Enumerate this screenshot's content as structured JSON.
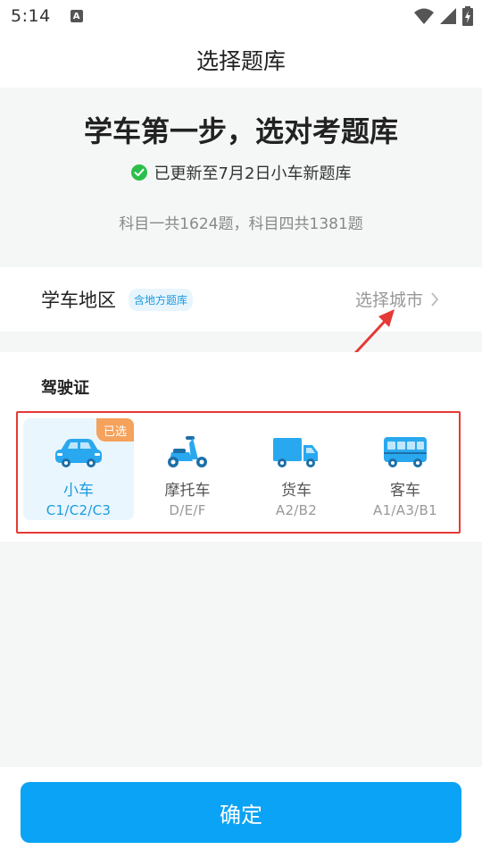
{
  "status_bar": {
    "time": "5:14",
    "notif_icon": "A"
  },
  "header": {
    "title": "选择题库"
  },
  "hero": {
    "headline": "学车第一步，选对考题库",
    "update_text": "已更新至7月2日小车新题库",
    "stats": "科目一共1624题，科目四共1381题"
  },
  "region": {
    "label": "学车地区",
    "badge": "含地方题库",
    "select_label": "选择城市"
  },
  "license": {
    "label": "驾驶证",
    "selected_badge": "已选",
    "vehicles": [
      {
        "name": "小车",
        "code": "C1/C2/C3",
        "icon": "car-icon",
        "selected": true
      },
      {
        "name": "摩托车",
        "code": "D/E/F",
        "icon": "motorcycle-icon",
        "selected": false
      },
      {
        "name": "货车",
        "code": "A2/B2",
        "icon": "truck-icon",
        "selected": false
      },
      {
        "name": "客车",
        "code": "A1/A3/B1",
        "icon": "bus-icon",
        "selected": false
      }
    ]
  },
  "footer": {
    "confirm_label": "确定"
  },
  "colors": {
    "accent": "#0aa3f5",
    "vehicle_blue": "#29a8ef",
    "badge_orange": "#f5a25d",
    "annotation_red": "#e53935",
    "check_green": "#2bbf4a"
  }
}
